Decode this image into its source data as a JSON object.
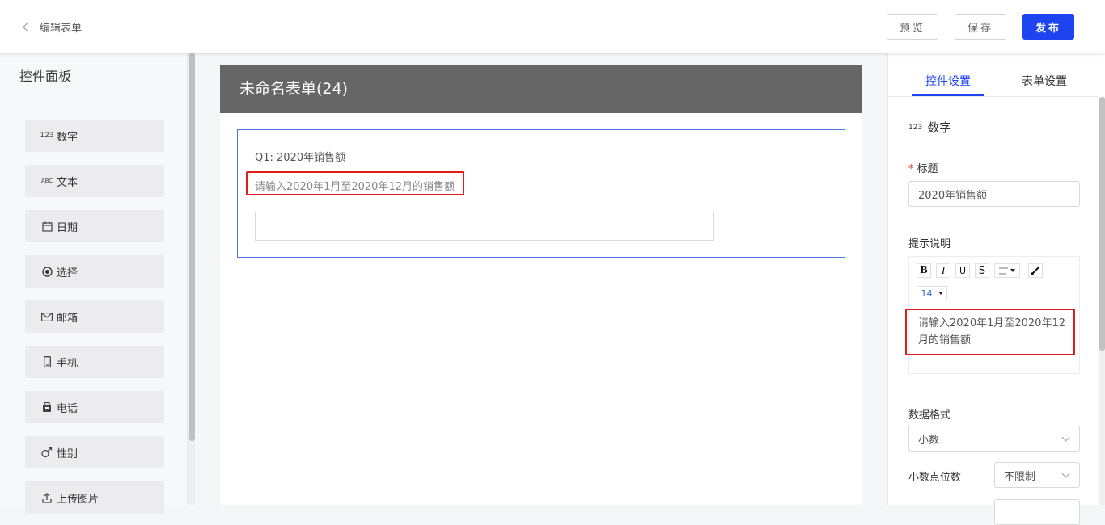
{
  "header": {
    "back_label": "编辑表单",
    "preview_label": "预览",
    "save_label": "保存",
    "publish_label": "发布",
    "publish_color": "#1d44f0"
  },
  "left_panel": {
    "title": "控件面板",
    "items": [
      {
        "label": "数字",
        "icon": "number-123-icon"
      },
      {
        "label": "文本",
        "icon": "text-abc-icon"
      },
      {
        "label": "日期",
        "icon": "calendar-icon"
      },
      {
        "label": "选择",
        "icon": "radio-icon"
      },
      {
        "label": "邮箱",
        "icon": "mail-icon"
      },
      {
        "label": "手机",
        "icon": "mobile-phone-icon"
      },
      {
        "label": "电话",
        "icon": "telephone-icon"
      },
      {
        "label": "性别",
        "icon": "gender-icon"
      },
      {
        "label": "上传图片",
        "icon": "upload-icon"
      }
    ]
  },
  "form": {
    "title": "未命名表单(24)",
    "question": {
      "title": "Q1: 2020年销售额",
      "hint": "请输入2020年1月至2020年12月的销售额",
      "value": ""
    }
  },
  "right_panel": {
    "tabs": [
      {
        "label": "控件设置",
        "active": true
      },
      {
        "label": "表单设置",
        "active": false
      }
    ],
    "control_type": {
      "icon_text": "123",
      "label": "数字"
    },
    "title_label": "标题",
    "title_value": "2020年销售额",
    "hint_label": "提示说明",
    "toolbar": {
      "bold": "B",
      "italic": "I",
      "underline": "U",
      "strike": "S",
      "font_size": "14"
    },
    "hint_text": "请输入2020年1月至2020年12月的销售额",
    "format_label": "数据格式",
    "format_value": "小数",
    "decimal_label": "小数点位数",
    "decimal_value": "不限制"
  },
  "colors": {
    "accent": "#1d44f0",
    "highlight_red": "#e21b1b",
    "form_header": "#666666"
  }
}
